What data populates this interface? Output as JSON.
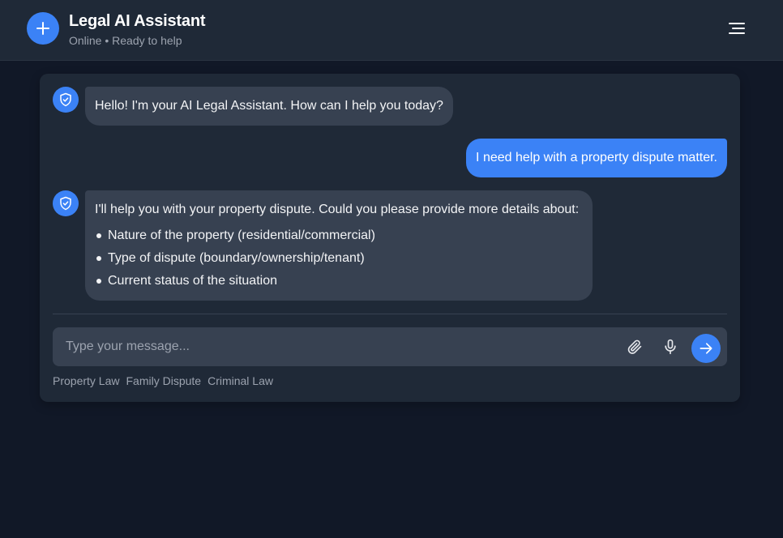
{
  "header": {
    "title": "Legal AI Assistant",
    "status": "Online • Ready to help",
    "logo_icon": "plus-icon",
    "menu_icon": "menu-icon"
  },
  "messages": [
    {
      "role": "assistant",
      "text": "Hello! I'm your AI Legal Assistant. How can I help you today?"
    },
    {
      "role": "user",
      "text": "I need help with a property dispute matter."
    },
    {
      "role": "assistant",
      "text": "I'll help you with your property dispute. Could you please provide more details about:",
      "items": [
        "Nature of the property (residential/commercial)",
        "Type of dispute (boundary/ownership/tenant)",
        "Current status of the situation"
      ]
    }
  ],
  "composer": {
    "placeholder": "Type your message...",
    "value": "",
    "attach_icon": "paperclip-icon",
    "mic_icon": "microphone-icon",
    "send_icon": "arrow-right-icon"
  },
  "quick_topics": [
    "Property Law",
    "Family Dispute",
    "Criminal Law"
  ],
  "colors": {
    "background": "#111827",
    "surface": "#1f2937",
    "bubble_bot": "#374151",
    "accent": "#3b82f6",
    "muted_text": "#9ca3af"
  }
}
